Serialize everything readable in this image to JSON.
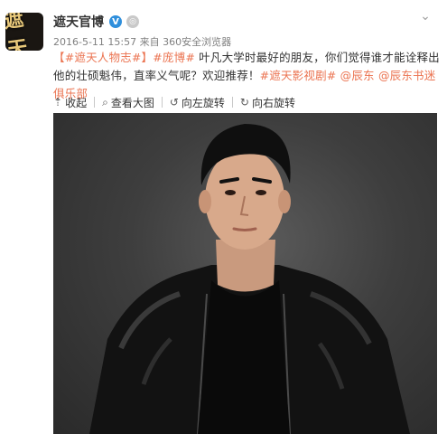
{
  "post": {
    "username": "遮天官博",
    "verified_icon": "verified-badge-icon",
    "avatar_text": "遮天",
    "timestamp": "2016-5-11 15:57",
    "source": "来自 360安全浏览器",
    "content": {
      "tag1": "【#遮天人物志#】",
      "tag2": "#庞博#",
      "text1": " 叶凡大学时最好的朋友，你们觉得谁才能诠释出他的壮硕魁伟，直率义气呢？欢迎推荐！",
      "tag3": "#遮天影视剧#",
      "mention1": "@辰东",
      "mention2": "@辰东书迷俱乐部"
    }
  },
  "toolbar": {
    "collapse": "收起",
    "view_large": "查看大图",
    "rotate_left": "向左旋转",
    "rotate_right": "向右旋转"
  },
  "colors": {
    "link": "#eb7350",
    "verified": "#2f8fdc"
  }
}
